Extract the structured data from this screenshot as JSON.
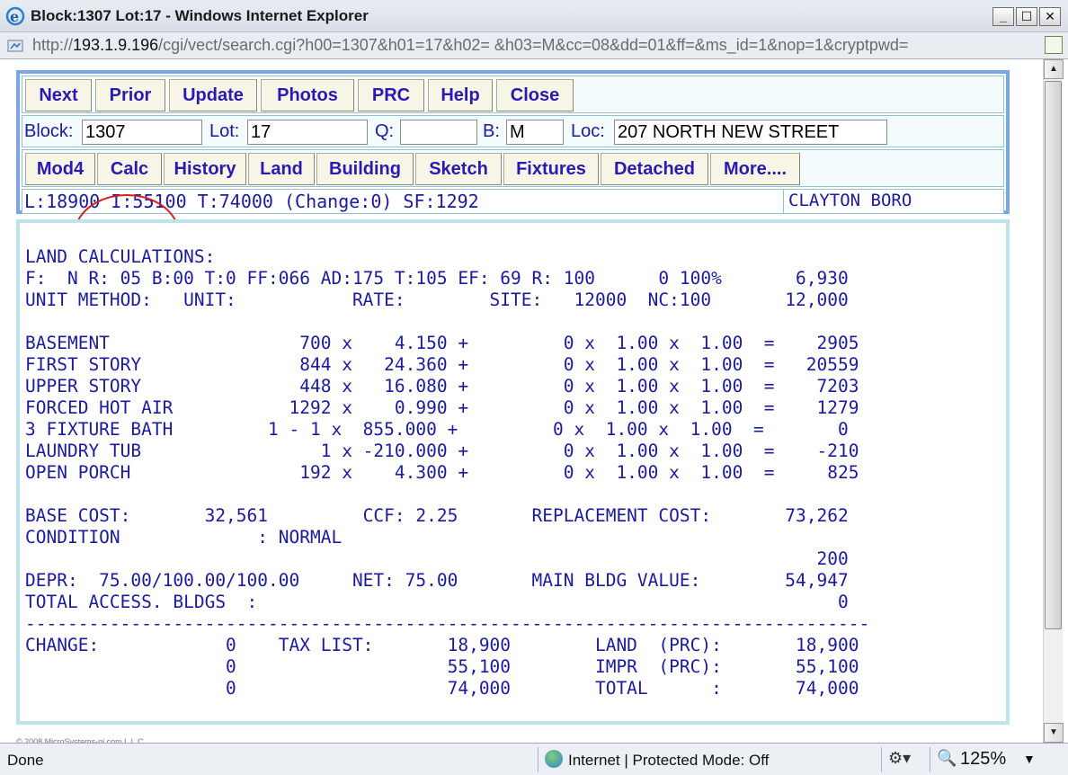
{
  "window": {
    "title": "Block:1307 Lot:17 - Windows Internet Explorer",
    "minimize": "_",
    "maximize": "☐",
    "close": "✕"
  },
  "address": {
    "prefix": "http://",
    "host": "193.1.9.196",
    "path": "/cgi/vect/search.cgi?h00=1307&h01=17&h02= &h03=M&cc=08&dd=01&ff=&ms_id=1&nop=1&cryptpwd="
  },
  "nav_buttons": [
    "Next",
    "Prior",
    "Update",
    "Photos",
    "PRC",
    "Help",
    "Close"
  ],
  "search": {
    "block_label": "Block:",
    "block_value": "1307",
    "lot_label": "Lot:",
    "lot_value": "17",
    "q_label": "Q:",
    "q_value": "",
    "b_label": "B:",
    "b_value": "M",
    "loc_label": "Loc:",
    "loc_value": "207 NORTH NEW STREET"
  },
  "view_buttons": [
    "Mod4",
    "Calc",
    "History",
    "Land",
    "Building",
    "Sketch",
    "Fixtures",
    "Detached",
    "More...."
  ],
  "summary": {
    "values_line": "L:18900 I:55100 T:74000 (Change:0) SF:1292",
    "township": "CLAYTON BORO"
  },
  "report": {
    "lines": [
      "LAND CALCULATIONS:",
      "F:  N R: 05 B:00 T:0 FF:066 AD:175 T:105 EF: 69 R: 100      0 100%       6,930",
      "UNIT METHOD:   UNIT:           RATE:        SITE:   12000  NC:100       12,000",
      "",
      "BASEMENT                  700 x    4.150 +         0 x  1.00 x  1.00  =    2905",
      "FIRST STORY               844 x   24.360 +         0 x  1.00 x  1.00  =   20559",
      "UPPER STORY               448 x   16.080 +         0 x  1.00 x  1.00  =    7203",
      "FORCED HOT AIR           1292 x    0.990 +         0 x  1.00 x  1.00  =    1279",
      "3 FIXTURE BATH         1 - 1 x  855.000 +         0 x  1.00 x  1.00  =       0",
      "LAUNDRY TUB                 1 x -210.000 +         0 x  1.00 x  1.00  =    -210",
      "OPEN PORCH                192 x    4.300 +         0 x  1.00 x  1.00  =     825",
      "",
      "BASE COST:       32,561         CCF: 2.25       REPLACEMENT COST:       73,262",
      "CONDITION             : NORMAL",
      "                                                                           200",
      "DEPR:  75.00/100.00/100.00     NET: 75.00       MAIN BLDG VALUE:        54,947",
      "TOTAL ACCESS. BLDGS  :                                                       0",
      "--------------------------------------------------------------------------------",
      "CHANGE:            0    TAX LIST:       18,900        LAND  (PRC):       18,900",
      "                   0                    55,100        IMPR  (PRC):       55,100",
      "                   0                    74,000        TOTAL      :       74,000"
    ]
  },
  "footer_small": "© 2008 MicroSystems-nj.com L.L.C.",
  "statusbar": {
    "status": "Done",
    "zone": "Internet | Protected Mode: Off",
    "zoom": "125%"
  }
}
